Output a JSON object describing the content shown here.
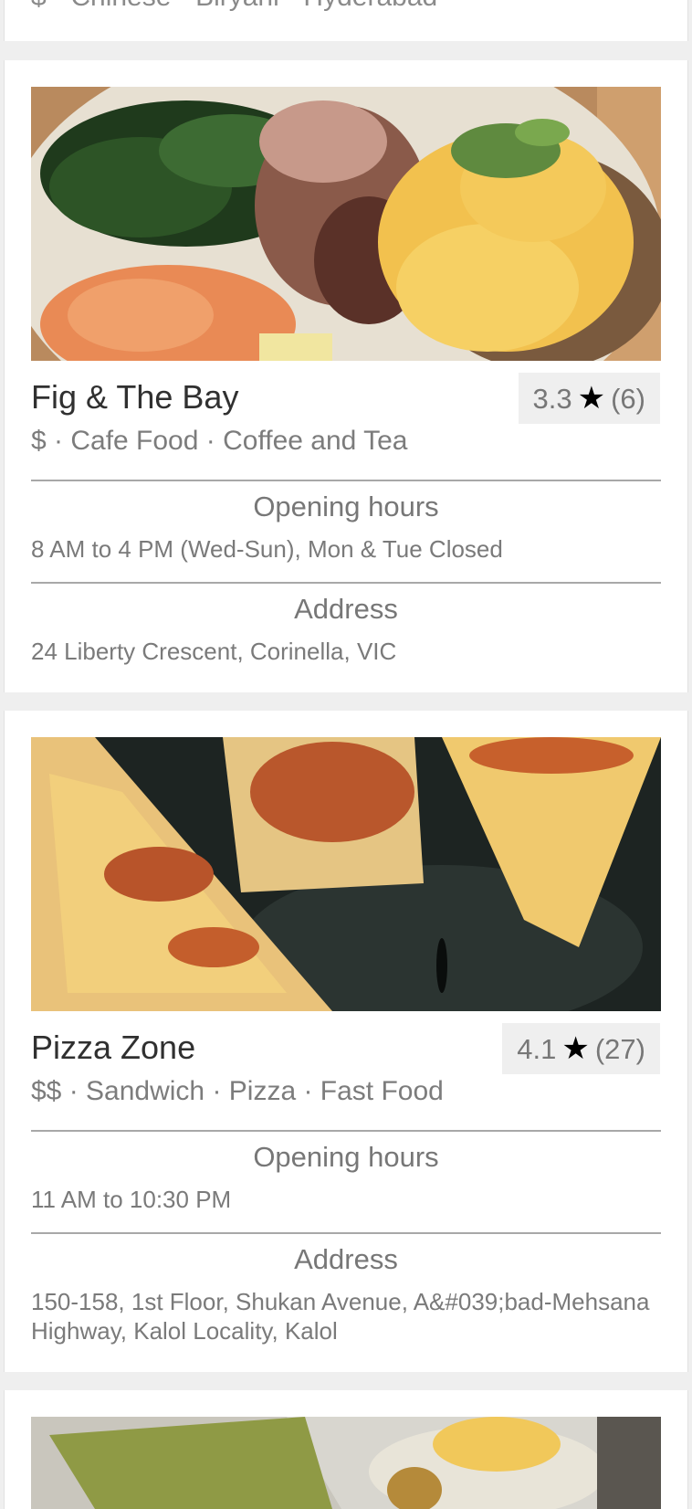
{
  "cards": [
    {
      "meta_line": "$ · Chinese · Biryani · Hyderabad"
    },
    {
      "name": "Fig & The Bay",
      "rating": {
        "score": "3.3",
        "star": "★",
        "count": "(6)"
      },
      "tags": "$ · Cafe Food · Coffee and Tea",
      "hours_title": "Opening hours",
      "hours": "8 AM to 4 PM (Wed-Sun), Mon & Tue Closed",
      "address_title": "Address",
      "address": "24 Liberty Crescent, Corinella, VIC",
      "photo_icon": "breakfast-plate-photo"
    },
    {
      "name": "Pizza Zone",
      "rating": {
        "score": "4.1",
        "star": "★",
        "count": "(27)"
      },
      "tags": "$$ · Sandwich · Pizza · Fast Food",
      "hours_title": "Opening hours",
      "hours": "11 AM to 10:30 PM",
      "address_title": "Address",
      "address": "150-158, 1st Floor, Shukan Avenue, A&#039;bad-Mehsana Highway, Kalol Locality, Kalol",
      "photo_icon": "pizza-slices-photo"
    },
    {
      "photo_icon": "cafe-table-photo"
    }
  ],
  "colors": {
    "page_bg": "#efefef",
    "card_bg": "#ffffff",
    "rating_bg": "#efefef",
    "title_text": "#303030",
    "muted_text": "#7a7a7a"
  }
}
